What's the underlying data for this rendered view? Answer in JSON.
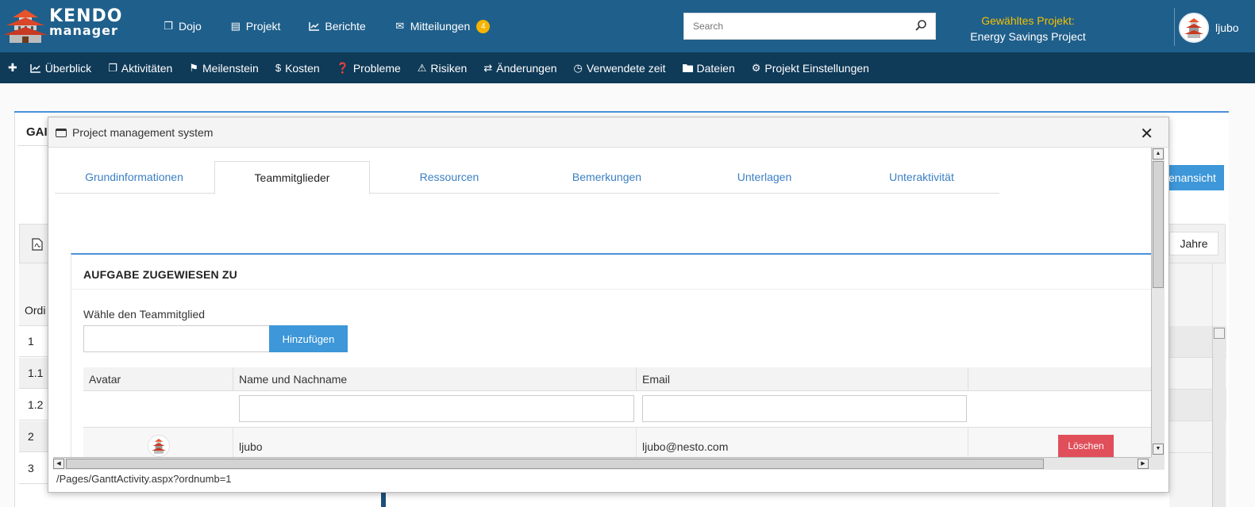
{
  "app": {
    "brand_line1": "KENDO",
    "brand_line2": "manager"
  },
  "topnav": {
    "items": [
      {
        "label": "Dojo",
        "icon": "clone-icon"
      },
      {
        "label": "Projekt",
        "icon": "document-icon"
      },
      {
        "label": "Berichte",
        "icon": "line-chart-icon"
      },
      {
        "label": "Mitteilungen",
        "icon": "envelope-icon",
        "badge": "4"
      }
    ],
    "search_placeholder": "Search",
    "selected_project_label": "Gewähltes Projekt:",
    "selected_project_value": "Energy Savings Project",
    "user_name": "ljubo"
  },
  "subnav": {
    "items": [
      {
        "label": "Überblick",
        "icon": "line-chart-icon"
      },
      {
        "label": "Aktivitäten",
        "icon": "files-icon"
      },
      {
        "label": "Meilenstein",
        "icon": "flag-icon"
      },
      {
        "label": "Kosten",
        "icon": "dollar-icon"
      },
      {
        "label": "Probleme",
        "icon": "question-icon"
      },
      {
        "label": "Risiken",
        "icon": "warning-icon"
      },
      {
        "label": "Änderungen",
        "icon": "exchange-icon"
      },
      {
        "label": "Verwendete zeit",
        "icon": "clock-icon"
      },
      {
        "label": "Dateien",
        "icon": "folder-icon"
      },
      {
        "label": "Projekt Einstellungen",
        "icon": "gears-icon"
      }
    ]
  },
  "background": {
    "title_fragment": "GAI",
    "button_fragment": "enansicht",
    "jahre_label": "Jahre",
    "column_fragment": "Ordi",
    "rows": [
      "1",
      "1.1",
      "1.2",
      "2",
      "3"
    ]
  },
  "modal": {
    "title": "Project management system",
    "tabs": [
      "Grundinformationen",
      "Teammitglieder",
      "Ressourcen",
      "Bemerkungen",
      "Unterlagen",
      "Unteraktivität"
    ],
    "active_tab": "Teammitglieder",
    "section_title": "AUFGABE ZUGEWIESEN ZU",
    "select_label": "Wähle den Teammitglied",
    "select_value": "",
    "add_button": "Hinzufügen",
    "grid": {
      "columns": [
        "Avatar",
        "Name und Nachname",
        "Email",
        ""
      ],
      "rows": [
        {
          "name": "ljubo",
          "email": "ljubo@nesto.com",
          "action": "Löschen"
        }
      ]
    },
    "status_url": "/Pages/GanttActivity.aspx?ordnumb=1"
  },
  "colors": {
    "topbar": "#1f5f8b",
    "subbar": "#0f3a58",
    "accent": "#3d97d8",
    "danger": "#e04f5a",
    "highlight": "#f5c000"
  }
}
